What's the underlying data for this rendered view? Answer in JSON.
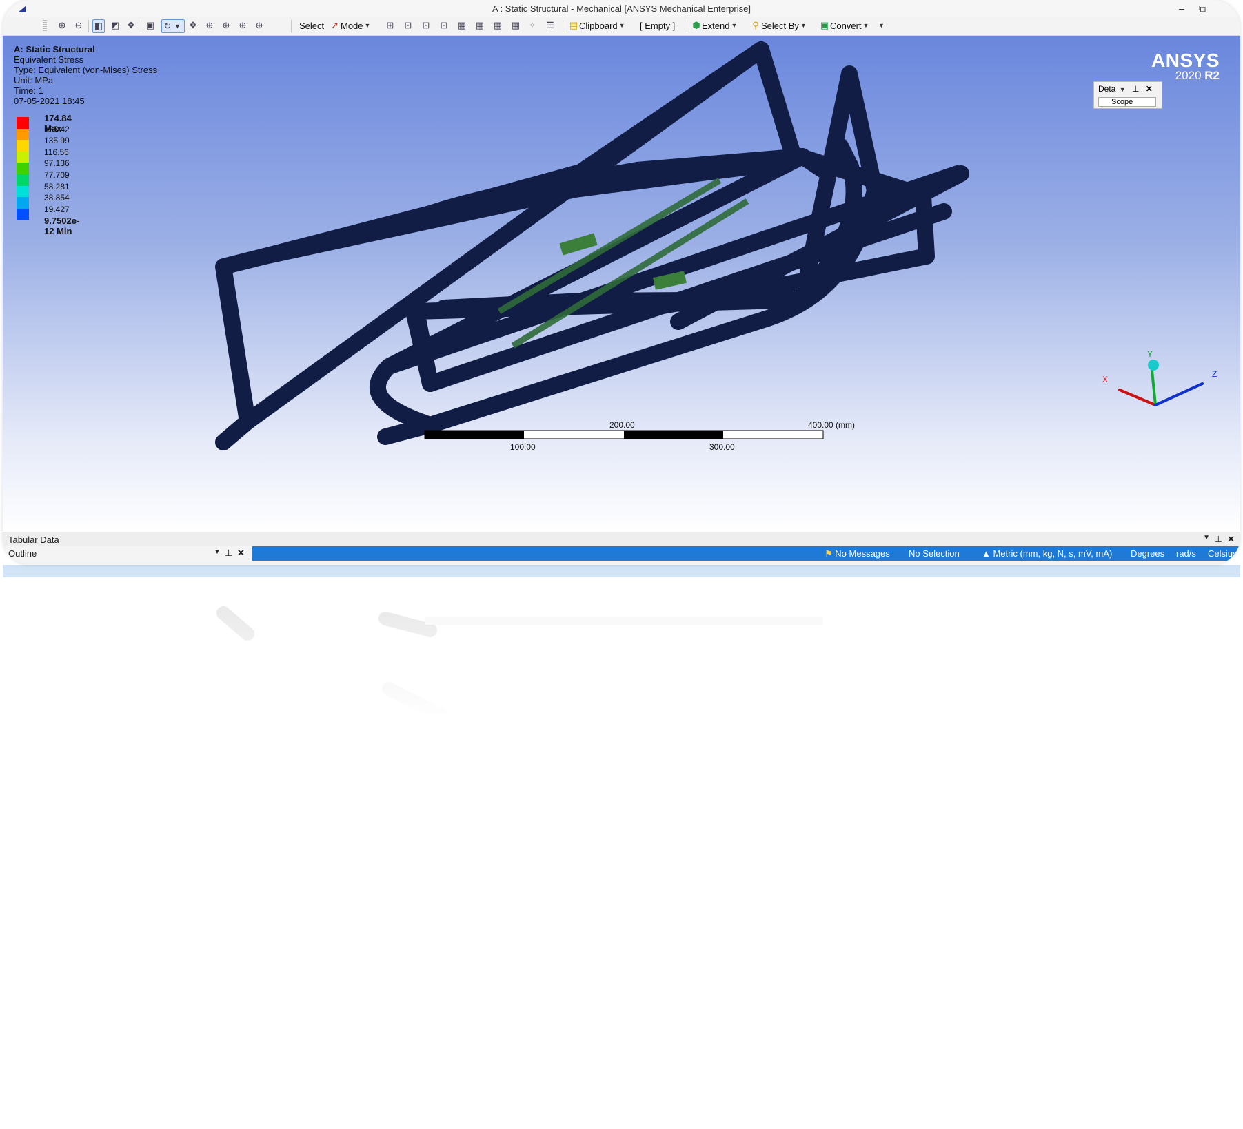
{
  "window": {
    "title": "A : Static Structural - Mechanical [ANSYS Mechanical Enterprise]",
    "minimize_icon": "minimize-icon",
    "restore_icon": "restore-icon"
  },
  "toolbar": {
    "select_label": "Select",
    "mode_label": "Mode",
    "clipboard_label": "Clipboard",
    "empty_label": "[ Empty ]",
    "extend_label": "Extend",
    "select_by_label": "Select By",
    "convert_label": "Convert"
  },
  "result": {
    "system": "A: Static Structural",
    "name": "Equivalent Stress",
    "type": "Type: Equivalent (von-Mises) Stress",
    "unit": "Unit: MPa",
    "time": "Time: 1",
    "timestamp": "07-05-2021 18:45"
  },
  "legend": {
    "max_label": "174.84 Max",
    "values": [
      "155.42",
      "135.99",
      "116.56",
      "97.136",
      "77.709",
      "58.281",
      "38.854",
      "19.427"
    ],
    "min_label": "9.7502e-12 Min",
    "colors": [
      "#ff0000",
      "#ff9a00",
      "#ffd700",
      "#c8f000",
      "#3fd000",
      "#00d66a",
      "#00e0d8",
      "#00a8f0",
      "#0050ff"
    ]
  },
  "logo": {
    "brand": "ANSYS",
    "version": "2020",
    "release": "R2"
  },
  "details_panel": {
    "title": "Deta",
    "scope": "Scope"
  },
  "scale_bar": {
    "top_labels": [
      "200.00",
      "400.00 (mm)"
    ],
    "bottom_labels": [
      "100.00",
      "300.00"
    ]
  },
  "triad": {
    "x": "X",
    "y": "Y",
    "z": "Z"
  },
  "colors": {
    "frame_tube": "#111d44",
    "accent": "#1e7ad6"
  },
  "tabular": {
    "title": "Tabular Data"
  },
  "outline": {
    "title": "Outline"
  },
  "status": {
    "messages": "No Messages",
    "selection": "No Selection",
    "units": "Metric (mm, kg, N, s, mV, mA)",
    "angle": "Degrees",
    "rate": "rad/s",
    "temperature": "Celsius"
  }
}
